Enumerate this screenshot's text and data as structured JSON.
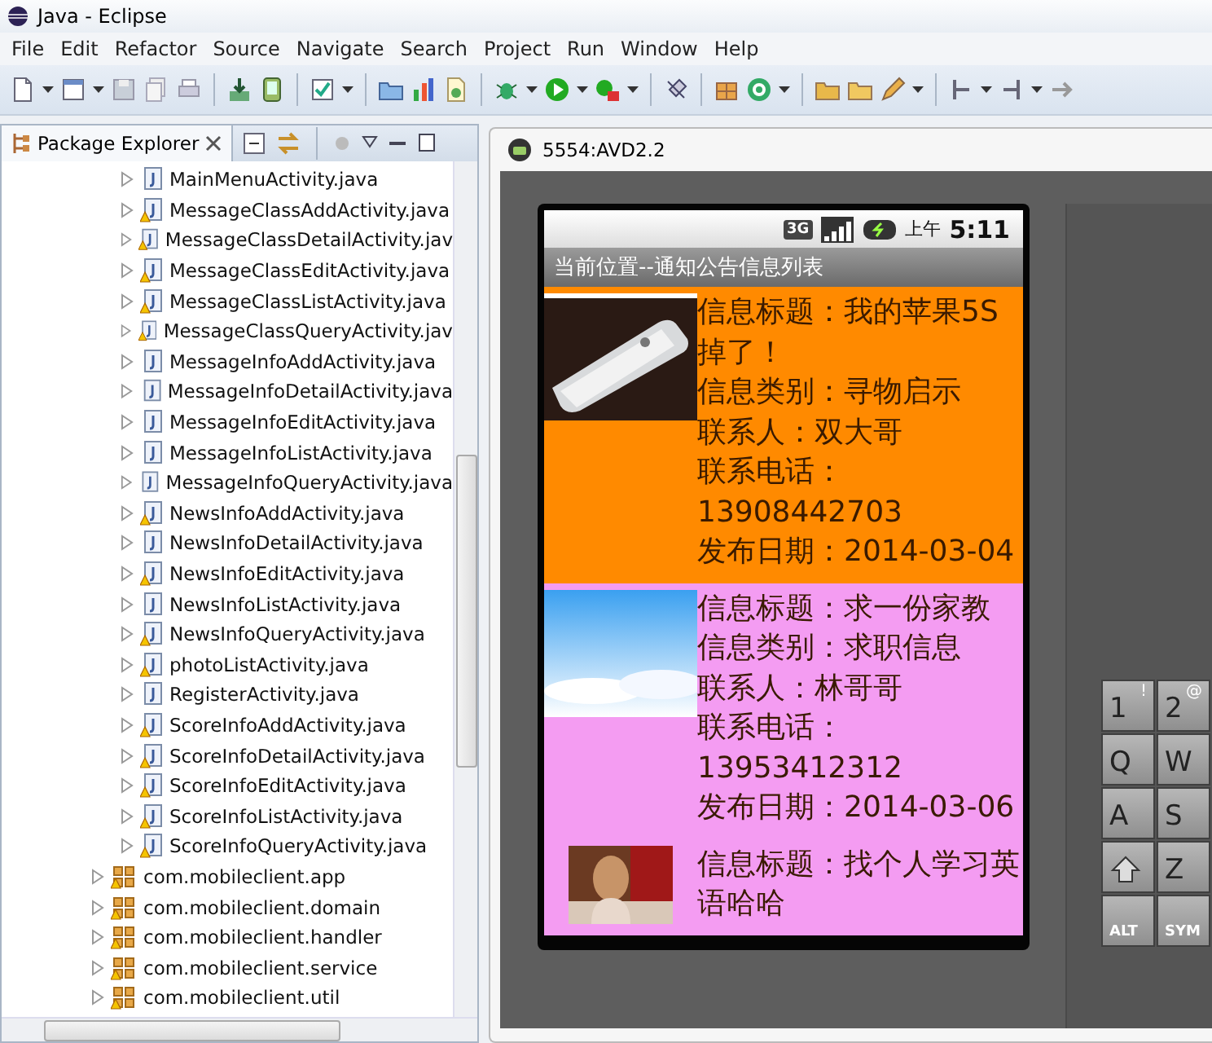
{
  "window": {
    "title": "Java - Eclipse"
  },
  "menu": [
    "File",
    "Edit",
    "Refactor",
    "Source",
    "Navigate",
    "Search",
    "Project",
    "Run",
    "Window",
    "Help"
  ],
  "package_explorer": {
    "title": "Package Explorer",
    "tree": [
      {
        "label": "MainMenuActivity.java",
        "kind": "file",
        "warning": false
      },
      {
        "label": "MessageClassAddActivity.java",
        "kind": "file",
        "warning": true
      },
      {
        "label": "MessageClassDetailActivity.jav",
        "kind": "file",
        "warning": true
      },
      {
        "label": "MessageClassEditActivity.java",
        "kind": "file",
        "warning": true
      },
      {
        "label": "MessageClassListActivity.java",
        "kind": "file",
        "warning": true
      },
      {
        "label": "MessageClassQueryActivity.jav",
        "kind": "file",
        "warning": true
      },
      {
        "label": "MessageInfoAddActivity.java",
        "kind": "file",
        "warning": false
      },
      {
        "label": "MessageInfoDetailActivity.java",
        "kind": "file",
        "warning": false
      },
      {
        "label": "MessageInfoEditActivity.java",
        "kind": "file",
        "warning": false
      },
      {
        "label": "MessageInfoListActivity.java",
        "kind": "file",
        "warning": false
      },
      {
        "label": "MessageInfoQueryActivity.java",
        "kind": "file",
        "warning": false
      },
      {
        "label": "NewsInfoAddActivity.java",
        "kind": "file",
        "warning": true
      },
      {
        "label": "NewsInfoDetailActivity.java",
        "kind": "file",
        "warning": false
      },
      {
        "label": "NewsInfoEditActivity.java",
        "kind": "file",
        "warning": true
      },
      {
        "label": "NewsInfoListActivity.java",
        "kind": "file",
        "warning": false
      },
      {
        "label": "NewsInfoQueryActivity.java",
        "kind": "file",
        "warning": true
      },
      {
        "label": "photoListActivity.java",
        "kind": "file",
        "warning": true
      },
      {
        "label": "RegisterActivity.java",
        "kind": "file",
        "warning": false
      },
      {
        "label": "ScoreInfoAddActivity.java",
        "kind": "file",
        "warning": true
      },
      {
        "label": "ScoreInfoDetailActivity.java",
        "kind": "file",
        "warning": true
      },
      {
        "label": "ScoreInfoEditActivity.java",
        "kind": "file",
        "warning": true
      },
      {
        "label": "ScoreInfoListActivity.java",
        "kind": "file",
        "warning": true
      },
      {
        "label": "ScoreInfoQueryActivity.java",
        "kind": "file",
        "warning": true
      },
      {
        "label": "com.mobileclient.app",
        "kind": "package",
        "warning": true
      },
      {
        "label": "com.mobileclient.domain",
        "kind": "package",
        "warning": true
      },
      {
        "label": "com.mobileclient.handler",
        "kind": "package",
        "warning": true
      },
      {
        "label": "com.mobileclient.service",
        "kind": "package",
        "warning": true
      },
      {
        "label": "com.mobileclient.util",
        "kind": "package",
        "warning": true
      }
    ]
  },
  "emulator": {
    "title": "5554:AVD2.2",
    "network": "3G",
    "time_prefix": "上午",
    "time": "5:11",
    "screen_title": "当前位置--通知公告信息列表",
    "items": [
      {
        "color": "#ff8a00",
        "lines": [
          "信息标题：我的苹果5S掉了！",
          "信息类别：寻物启示",
          "联系人：双大哥",
          "联系电话：13908442703",
          "发布日期：2014-03-04"
        ]
      },
      {
        "color": "#f49cf2",
        "lines": [
          "信息标题：求一份家教",
          "信息类别：求职信息",
          "联系人：林哥哥",
          "联系电话：13953412312",
          "发布日期：2014-03-06"
        ]
      },
      {
        "color": "#f49cf2",
        "lines": [
          "信息标题：找个人学习英语哈哈"
        ]
      }
    ],
    "keys": [
      {
        "kind": "char",
        "label": "1",
        "hint": "!"
      },
      {
        "kind": "char",
        "label": "2",
        "hint": "@"
      },
      {
        "kind": "char",
        "label": "Q"
      },
      {
        "kind": "char",
        "label": "W"
      },
      {
        "kind": "char",
        "label": "A"
      },
      {
        "kind": "char",
        "label": "S"
      },
      {
        "kind": "shift"
      },
      {
        "kind": "char",
        "label": "Z"
      },
      {
        "kind": "small",
        "label": "ALT"
      },
      {
        "kind": "small",
        "label": "SYM"
      }
    ]
  }
}
